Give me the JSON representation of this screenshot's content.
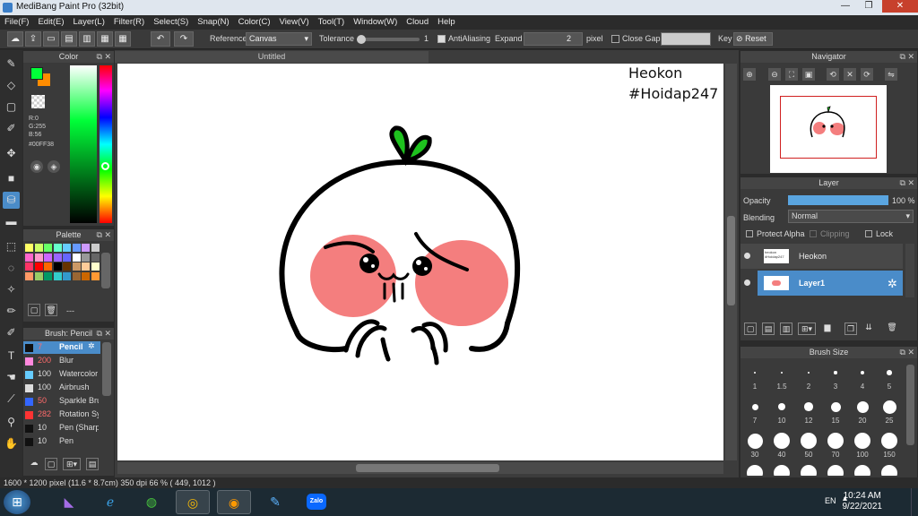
{
  "window": {
    "title": "MediBang Paint Pro (32bit)",
    "min": "—",
    "max": "❐",
    "close": "✕"
  },
  "menu": [
    "File(F)",
    "Edit(E)",
    "Layer(L)",
    "Filter(R)",
    "Select(S)",
    "Snap(N)",
    "Color(C)",
    "View(V)",
    "Tool(T)",
    "Window(W)",
    "Cloud",
    "Help"
  ],
  "toolbar": {
    "reference_label": "Reference",
    "reference_value": "Canvas",
    "tolerance_label": "Tolerance",
    "tolerance_value": "1",
    "antialiasing_label": "AntiAliasing",
    "expand_label": "Expand",
    "expand_value": "2",
    "expand_unit": "pixel",
    "closegaps_label": "Close Gaps",
    "key_label": "Key",
    "reset_label": "Reset"
  },
  "color_panel": {
    "title": "Color",
    "r": "R:0",
    "g": "G:255",
    "b": "B:56",
    "hex": "#00FF38",
    "primary": "#00ff38",
    "secondary": "#ff8c00"
  },
  "palette_panel": {
    "title": "Palette",
    "footer": "---",
    "colors": [
      "#ffff66",
      "#ccff66",
      "#66ff66",
      "#66ffcc",
      "#66ccff",
      "#6699ff",
      "#cc99ff",
      "#cccccc",
      "#ff66cc",
      "#ff99cc",
      "#cc66ff",
      "#9966ff",
      "#6666ff",
      "#ffffff",
      "#999999",
      "#666666",
      "#ff3366",
      "#ff0000",
      "#ff6600",
      "#000000",
      "#663300",
      "#cc9966",
      "#ffcc99",
      "#ffffcc",
      "#ff9966",
      "#99cc66",
      "#009966",
      "#33cccc",
      "#3399cc",
      "#996633",
      "#cc6600",
      "#ff9933"
    ]
  },
  "brush_panel": {
    "title": "Brush: Pencil",
    "items": [
      {
        "size": "7",
        "name": "Pencil",
        "color": "#111111"
      },
      {
        "size": "200",
        "name": "Blur",
        "color": "#ff88dd"
      },
      {
        "size": "100",
        "name": "Watercolor",
        "color": "#66ccff"
      },
      {
        "size": "100",
        "name": "Airbrush",
        "color": "#dddddd"
      },
      {
        "size": "50",
        "name": "Sparkle Brush",
        "color": "#3366ff"
      },
      {
        "size": "282",
        "name": "Rotation Symmetry",
        "color": "#ff3333"
      },
      {
        "size": "10",
        "name": "Pen (Sharp)",
        "color": "#111111"
      },
      {
        "size": "10",
        "name": "Pen",
        "color": "#111111"
      }
    ]
  },
  "canvas": {
    "tab": "Untitled",
    "text1": "Heokon",
    "text2": "#Hoidap247"
  },
  "navigator": {
    "title": "Navigator"
  },
  "layer_panel": {
    "title": "Layer",
    "opacity_label": "Opacity",
    "opacity_value": "100 %",
    "opacity_fraction": 1.0,
    "blending_label": "Blending",
    "blending_value": "Normal",
    "protect_alpha": "Protect Alpha",
    "clipping": "Clipping",
    "lock": "Lock",
    "layers": [
      {
        "name": "Heokon",
        "thumb": "heokon #Hoidap247"
      },
      {
        "name": "Layer1"
      }
    ]
  },
  "brush_size_panel": {
    "title": "Brush Size",
    "sizes": [
      "1",
      "1.5",
      "2",
      "3",
      "4",
      "5",
      "7",
      "10",
      "12",
      "15",
      "20",
      "25",
      "30",
      "40",
      "50",
      "70",
      "100",
      "150"
    ]
  },
  "status": {
    "text": "1600 * 1200 pixel   (11.6 * 8.7cm)   350 dpi   66 %   ( 449, 1012 )"
  },
  "taskbar": {
    "lang": "EN",
    "time": "10:24 AM",
    "date": "9/22/2021",
    "apps": [
      "Start",
      "Visual Studio",
      "Internet Explorer",
      "App",
      "Chrome",
      "MediBang",
      "Paint",
      "Zalo"
    ],
    "zalo_label": "Zalo"
  }
}
